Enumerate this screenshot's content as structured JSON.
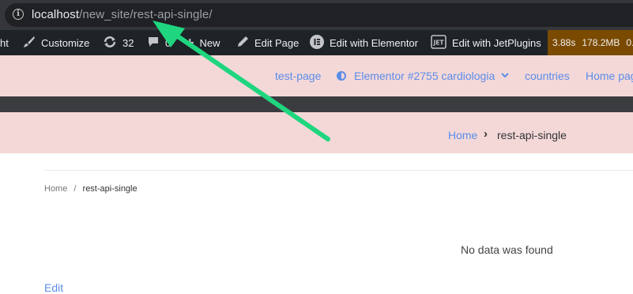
{
  "browser": {
    "url_host": "localhost",
    "url_path": "/new_site/rest-api-single/"
  },
  "adminbar": {
    "cut_label": "ht",
    "customize": "Customize",
    "updates_count": "32",
    "comments_count": "0",
    "new_label": "New",
    "edit_page": "Edit Page",
    "edit_elementor": "Edit with Elementor",
    "edit_jetplugins": "Edit with JetPlugins",
    "qm_time": "3.88s",
    "qm_memory": "178.2MB",
    "qm_extra": "0."
  },
  "nav": {
    "items": [
      "test-page",
      "Elementor #2755 cardiologia",
      "countries",
      "Home page"
    ]
  },
  "breadcrumb_band": {
    "home": "Home",
    "separator": "›",
    "current": "rest-api-single"
  },
  "content": {
    "crumb_home": "Home",
    "crumb_sep": "/",
    "crumb_current": "rest-api-single",
    "no_data": "No data was found",
    "edit_link": "Edit"
  },
  "colors": {
    "accent_link": "#5b8de8",
    "header_bg": "#f4d8d8",
    "annotation_arrow": "#1fd67f"
  }
}
